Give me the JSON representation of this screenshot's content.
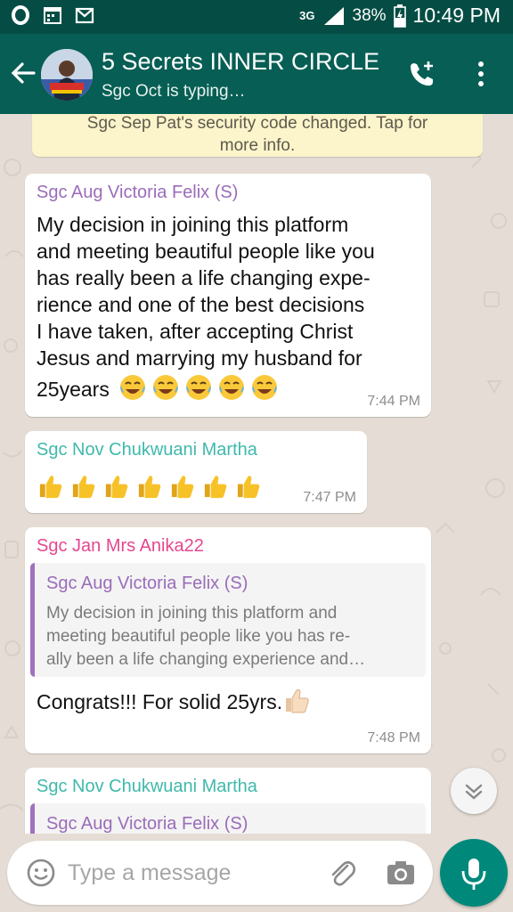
{
  "status_bar": {
    "network_type": "3G",
    "battery": "38%",
    "time": "10:49 PM"
  },
  "header": {
    "title": "5 Secrets INNER CIRCLE",
    "subtitle": "Sgc Oct is typing…",
    "icons": [
      "back-arrow-icon",
      "group-avatar",
      "add-call-icon",
      "more-vert-icon"
    ]
  },
  "notice": {
    "text": "Sgc Sep Pat's security code changed. Tap for more info."
  },
  "messages": [
    {
      "sender": "Sgc Aug Victoria Felix (S)",
      "sender_color": "#9a6cb9",
      "lines": [
        "My decision in joining this platform",
        "and meeting beautiful people like you",
        "has really been a life changing expe-",
        "rience and one of the best decisions",
        "I have taken, after accepting Christ",
        "Jesus and marrying my husband for",
        "25years"
      ],
      "emoji": "face-with-tears-of-joy x5",
      "time": "7:44 PM"
    },
    {
      "sender": "Sgc Nov Chukwuani Martha",
      "sender_color": "#3fb9ab",
      "emoji": "thumbs-up x7",
      "time": "7:47 PM"
    },
    {
      "sender": "Sgc Jan Mrs Anika22",
      "sender_color": "#e5478e",
      "quote": {
        "sender": "Sgc Aug Victoria Felix (S)",
        "lines": [
          "My decision in joining this platform and",
          "meeting beautiful people like you has re-",
          "ally been a life changing experience and…"
        ]
      },
      "text": "Congrats!!! For solid 25yrs.",
      "emoji": "thumbs-up-light-skin",
      "time": "7:48 PM"
    },
    {
      "sender": "Sgc Nov Chukwuani Martha",
      "sender_color": "#3fb9ab",
      "quote": {
        "sender": "Sgc Aug Victoria Felix (S)"
      }
    }
  ],
  "input": {
    "placeholder": "Type a message",
    "value": ""
  },
  "colors": {
    "header": "#075e54",
    "status_bar": "#054d44",
    "accent_fab": "#00897b",
    "chat_bg": "#e5ddd5",
    "notice_bg": "#fcf4cb"
  }
}
